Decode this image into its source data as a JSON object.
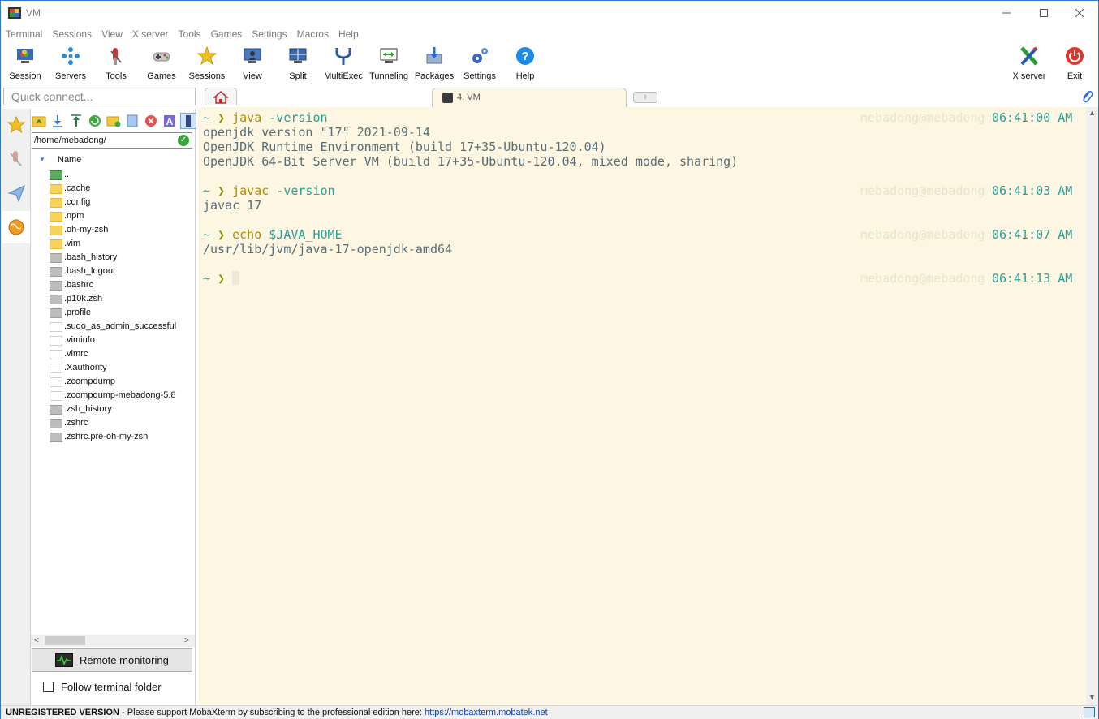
{
  "window": {
    "title": "VM"
  },
  "menu": [
    "Terminal",
    "Sessions",
    "View",
    "X server",
    "Tools",
    "Games",
    "Settings",
    "Macros",
    "Help"
  ],
  "toolbar": {
    "left": [
      "Session",
      "Servers",
      "Tools",
      "Games",
      "Sessions",
      "View",
      "Split",
      "MultiExec",
      "Tunneling",
      "Packages",
      "Settings",
      "Help"
    ],
    "right": [
      "X server",
      "Exit"
    ]
  },
  "quick_connect": {
    "placeholder": "Quick connect..."
  },
  "tabs": {
    "active_label": "4. VM",
    "new_tab": "+"
  },
  "sftp": {
    "path": "/home/mebadong/",
    "column_name": "Name",
    "files": [
      {
        "name": "..",
        "kind": "up"
      },
      {
        "name": ".cache",
        "kind": "folder"
      },
      {
        "name": ".config",
        "kind": "folder"
      },
      {
        "name": ".npm",
        "kind": "folder"
      },
      {
        "name": ".oh-my-zsh",
        "kind": "folder"
      },
      {
        "name": ".vim",
        "kind": "folder"
      },
      {
        "name": ".bash_history",
        "kind": "gray"
      },
      {
        "name": ".bash_logout",
        "kind": "gray"
      },
      {
        "name": ".bashrc",
        "kind": "gray"
      },
      {
        "name": ".p10k.zsh",
        "kind": "gray"
      },
      {
        "name": ".profile",
        "kind": "gray"
      },
      {
        "name": ".sudo_as_admin_successful",
        "kind": "text"
      },
      {
        "name": ".viminfo",
        "kind": "text"
      },
      {
        "name": ".vimrc",
        "kind": "text"
      },
      {
        "name": ".Xauthority",
        "kind": "text"
      },
      {
        "name": ".zcompdump",
        "kind": "text"
      },
      {
        "name": ".zcompdump-mebadong-5.8",
        "kind": "text"
      },
      {
        "name": ".zsh_history",
        "kind": "gray"
      },
      {
        "name": ".zshrc",
        "kind": "gray"
      },
      {
        "name": ".zshrc.pre-oh-my-zsh",
        "kind": "gray"
      }
    ],
    "remote_monitoring": "Remote monitoring",
    "follow_folder": "Follow terminal folder"
  },
  "terminal": {
    "prompt_tilde": "~",
    "prompt_arrow": "❯",
    "user_host": "mebadong@mebadong",
    "blocks": [
      {
        "cmd": "java",
        "args": " -version",
        "time": "06:41:00 AM",
        "output": [
          "openjdk version \"17\" 2021-09-14",
          "OpenJDK Runtime Environment (build 17+35-Ubuntu-120.04)",
          "OpenJDK 64-Bit Server VM (build 17+35-Ubuntu-120.04, mixed mode, sharing)"
        ]
      },
      {
        "cmd": "javac",
        "args": " -version",
        "time": "06:41:03 AM",
        "output": [
          "javac 17"
        ]
      },
      {
        "cmd": "echo",
        "args": " $JAVA_HOME",
        "time": "06:41:07 AM",
        "output": [
          "/usr/lib/jvm/java-17-openjdk-amd64"
        ]
      },
      {
        "cmd": "",
        "args": "",
        "time": "06:41:13 AM",
        "output": []
      }
    ]
  },
  "status": {
    "unregistered": "UNREGISTERED VERSION",
    "message": "  -  Please support MobaXterm by subscribing to the professional edition here:  ",
    "link": "https://mobaxterm.mobatek.net"
  }
}
